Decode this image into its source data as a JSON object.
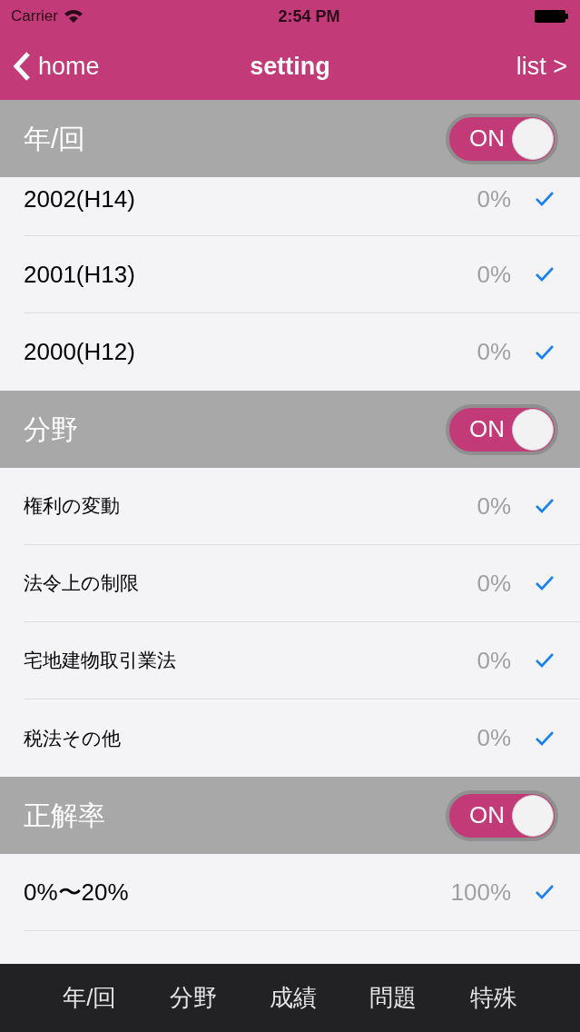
{
  "status_bar": {
    "carrier": "Carrier",
    "time": "2:54 PM"
  },
  "nav": {
    "back": "home",
    "title": "setting",
    "next": "list >"
  },
  "sections": [
    {
      "title": "年/回",
      "on": true,
      "toggle_label": "ON",
      "rows": [
        {
          "label": "2002(H14)",
          "value": "0%",
          "checked": true,
          "kind": "year"
        },
        {
          "label": "2001(H13)",
          "value": "0%",
          "checked": true,
          "kind": "year"
        },
        {
          "label": "2000(H12)",
          "value": "0%",
          "checked": true,
          "kind": "year"
        }
      ]
    },
    {
      "title": "分野",
      "on": true,
      "toggle_label": "ON",
      "rows": [
        {
          "label": "権利の変動",
          "value": "0%",
          "checked": true,
          "kind": "field"
        },
        {
          "label": "法令上の制限",
          "value": "0%",
          "checked": true,
          "kind": "field"
        },
        {
          "label": "宅地建物取引業法",
          "value": "0%",
          "checked": true,
          "kind": "field"
        },
        {
          "label": "税法その他",
          "value": "0%",
          "checked": true,
          "kind": "field"
        }
      ]
    },
    {
      "title": "正解率",
      "on": true,
      "toggle_label": "ON",
      "rows": [
        {
          "label": "0%〜20%",
          "value": "100%",
          "checked": true,
          "kind": "year"
        }
      ]
    }
  ],
  "tab_bar": [
    "年/回",
    "分野",
    "成績",
    "問題",
    "特殊"
  ]
}
